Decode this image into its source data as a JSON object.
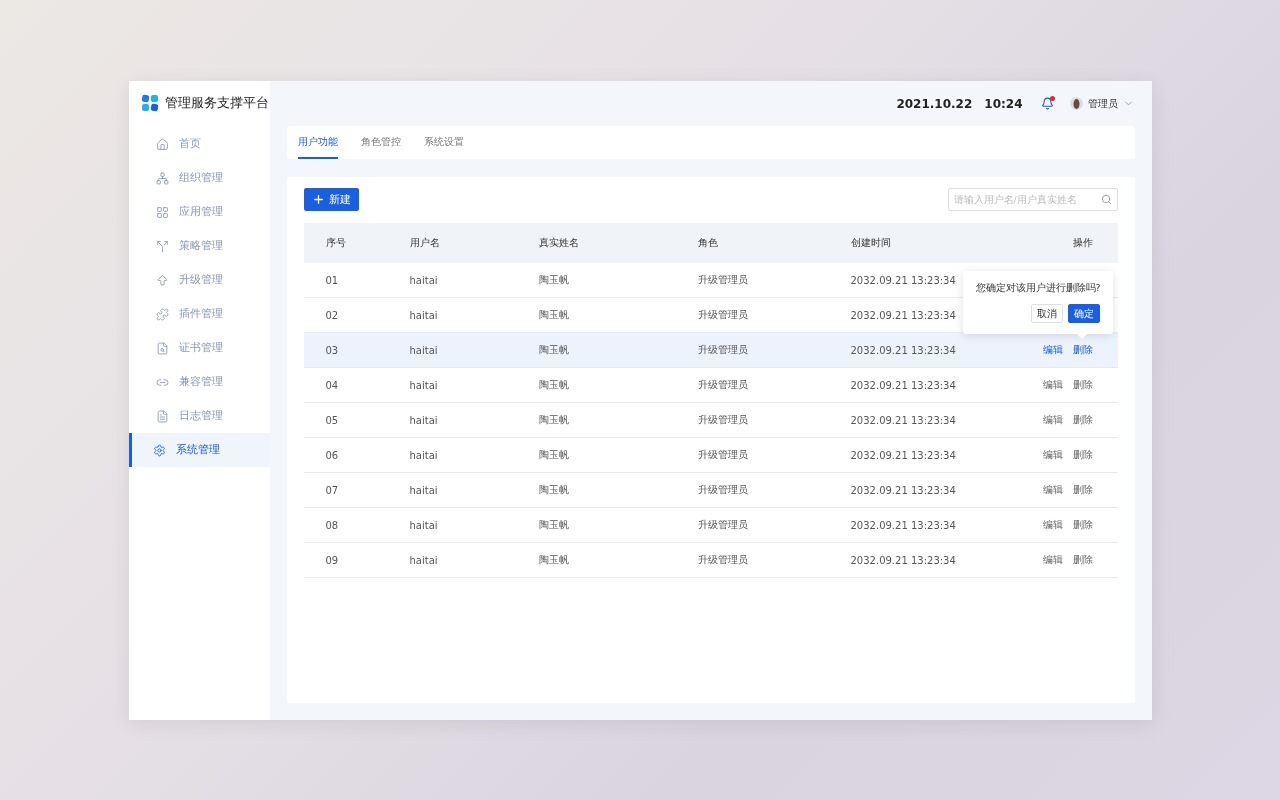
{
  "app": {
    "title": "管理服务支撑平台"
  },
  "sidebar": {
    "items": [
      {
        "label": "首页",
        "kind": "home",
        "selected": false
      },
      {
        "label": "组织管理",
        "kind": "org",
        "selected": false
      },
      {
        "label": "应用管理",
        "kind": "apps",
        "selected": false
      },
      {
        "label": "策略管理",
        "kind": "policy",
        "selected": false
      },
      {
        "label": "升级管理",
        "kind": "upgrade",
        "selected": false
      },
      {
        "label": "插件管理",
        "kind": "plugin",
        "selected": false
      },
      {
        "label": "证书管理",
        "kind": "cert",
        "selected": false
      },
      {
        "label": "兼容管理",
        "kind": "compat",
        "selected": false
      },
      {
        "label": "日志管理",
        "kind": "log",
        "selected": false
      },
      {
        "label": "系统管理",
        "kind": "system",
        "selected": true
      }
    ]
  },
  "header": {
    "date": "2021.10.22",
    "time": "10:24",
    "notification_unread": true,
    "user": "管理员"
  },
  "tabs": [
    {
      "label": "用户功能",
      "selected": true
    },
    {
      "label": "角色管控",
      "selected": false
    },
    {
      "label": "系统设置",
      "selected": false
    }
  ],
  "toolbar": {
    "new_button": "新建",
    "search": {
      "placeholder": "请输入用户名/用户真实姓名"
    }
  },
  "table": {
    "columns": [
      "序号",
      "用户名",
      "真实姓名",
      "角色",
      "创建时间",
      "操作"
    ],
    "rows": [
      {
        "index": "01",
        "username": "haitai",
        "real_name": "陶玉帆",
        "role": "升级管理员",
        "created": "2032.09.21 13:23:34",
        "selected": false
      },
      {
        "index": "02",
        "username": "haitai",
        "real_name": "陶玉帆",
        "role": "升级管理员",
        "created": "2032.09.21 13:23:34",
        "selected": false
      },
      {
        "index": "03",
        "username": "haitai",
        "real_name": "陶玉帆",
        "role": "升级管理员",
        "created": "2032.09.21 13:23:34",
        "selected": true,
        "actions": [
          "编辑",
          "删除"
        ],
        "confirm": {
          "message": "您确定对该用户进行删除吗?",
          "cancel": "取消",
          "ok": "确定"
        }
      },
      {
        "index": "04",
        "username": "haitai",
        "real_name": "陶玉帆",
        "role": "升级管理员",
        "created": "2032.09.21 13:23:34",
        "selected": false,
        "actions": [
          "编辑",
          "删除"
        ]
      },
      {
        "index": "05",
        "username": "haitai",
        "real_name": "陶玉帆",
        "role": "升级管理员",
        "created": "2032.09.21 13:23:34",
        "selected": false,
        "actions": [
          "编辑",
          "删除"
        ]
      },
      {
        "index": "06",
        "username": "haitai",
        "real_name": "陶玉帆",
        "role": "升级管理员",
        "created": "2032.09.21 13:23:34",
        "selected": false,
        "actions": [
          "编辑",
          "删除"
        ]
      },
      {
        "index": "07",
        "username": "haitai",
        "real_name": "陶玉帆",
        "role": "升级管理员",
        "created": "2032.09.21 13:23:34",
        "selected": false,
        "actions": [
          "编辑",
          "删除"
        ]
      },
      {
        "index": "08",
        "username": "haitai",
        "real_name": "陶玉帆",
        "role": "升级管理员",
        "created": "2032.09.21 13:23:34",
        "selected": false,
        "actions": [
          "编辑",
          "删除"
        ]
      },
      {
        "index": "09",
        "username": "haitai",
        "real_name": "陶玉帆",
        "role": "升级管理员",
        "created": "2032.09.21 13:23:34",
        "selected": false,
        "actions": [
          "编辑",
          "删除"
        ]
      }
    ]
  }
}
